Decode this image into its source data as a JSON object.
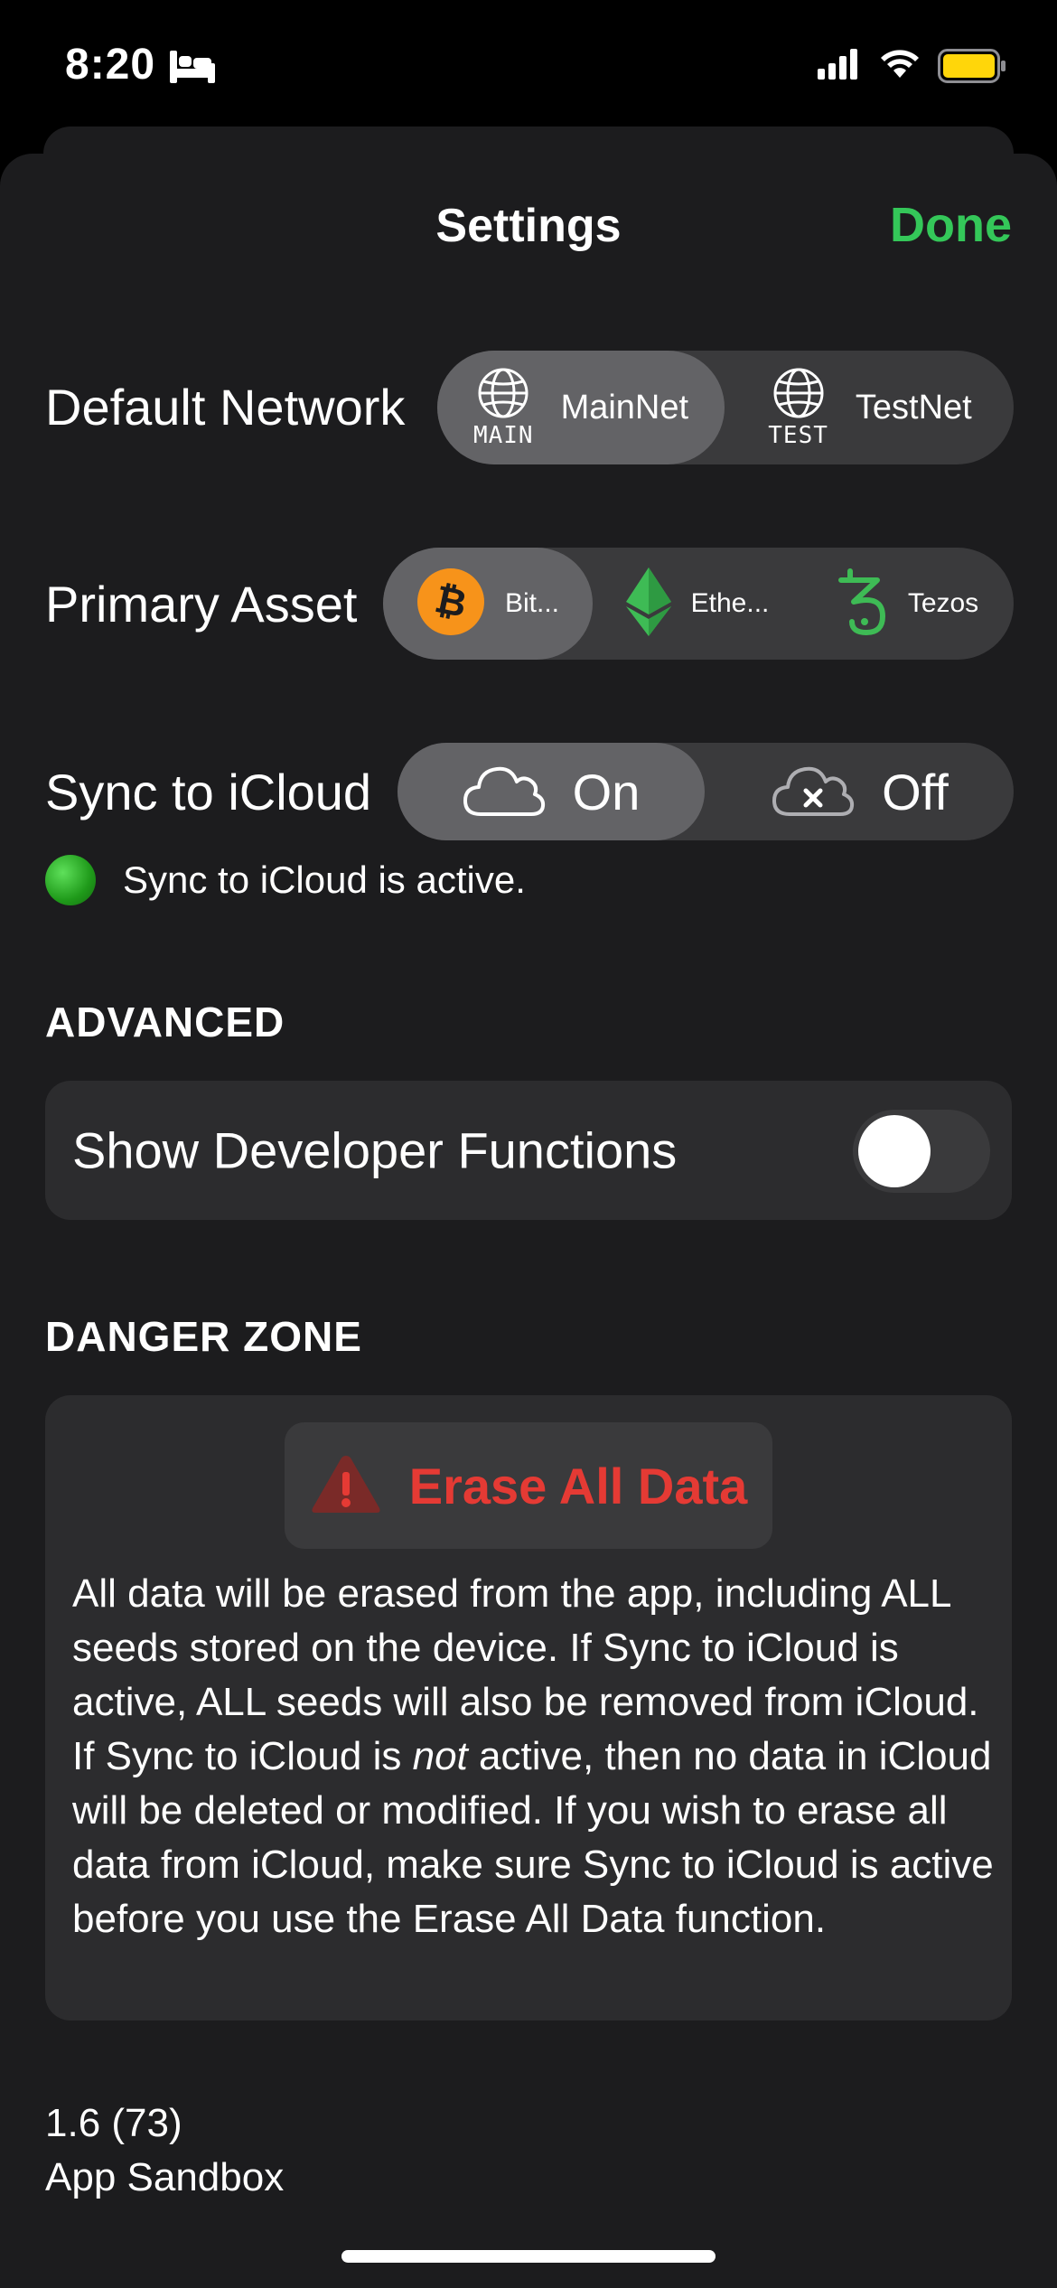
{
  "status_bar": {
    "time": "8:20",
    "icons": [
      "sleep-bed-icon",
      "cellular-signal-icon",
      "wifi-icon",
      "battery-icon"
    ],
    "battery_color": "#ffd60a"
  },
  "header": {
    "title": "Settings",
    "done_label": "Done"
  },
  "default_network": {
    "label": "Default Network",
    "options": [
      {
        "icon": "globe-icon",
        "caption": "MAIN",
        "label": "MainNet",
        "selected": true
      },
      {
        "icon": "globe-icon",
        "caption": "TEST",
        "label": "TestNet",
        "selected": false
      }
    ]
  },
  "primary_asset": {
    "label": "Primary Asset",
    "options": [
      {
        "icon": "bitcoin-icon",
        "label": "Bit...",
        "selected": true
      },
      {
        "icon": "ethereum-icon",
        "label": "Ethe...",
        "selected": false
      },
      {
        "icon": "tezos-icon",
        "label": "Tezos",
        "selected": false
      }
    ]
  },
  "sync_icloud": {
    "label": "Sync to iCloud",
    "options": [
      {
        "icon": "cloud-icon",
        "label": "On",
        "selected": true
      },
      {
        "icon": "cloud-x-icon",
        "label": "Off",
        "selected": false
      }
    ],
    "status_text": "Sync to iCloud is active."
  },
  "advanced": {
    "header": "ADVANCED",
    "developer_label": "Show Developer Functions",
    "developer_enabled": false
  },
  "danger_zone": {
    "header": "DANGER ZONE",
    "erase_label": "Erase All Data",
    "warning_before": "All data will be erased from the app, including ALL seeds stored on the device. If Sync to iCloud is active, ALL seeds will also be removed from iCloud. If Sync to iCloud is ",
    "warning_em": "not",
    "warning_after": " active, then no data in iCloud will be deleted or modified. If you wish to erase all data from iCloud, make sure Sync to iCloud is active before you use the Erase All Data function."
  },
  "footer": {
    "version": "1.6 (73)",
    "environment": "App Sandbox"
  },
  "colors": {
    "accent_green": "#34c759",
    "danger_red": "#e53a34",
    "bitcoin_orange": "#f7931a",
    "ethereum_green": "#3ebb55",
    "tezos_green": "#3ebb55"
  }
}
